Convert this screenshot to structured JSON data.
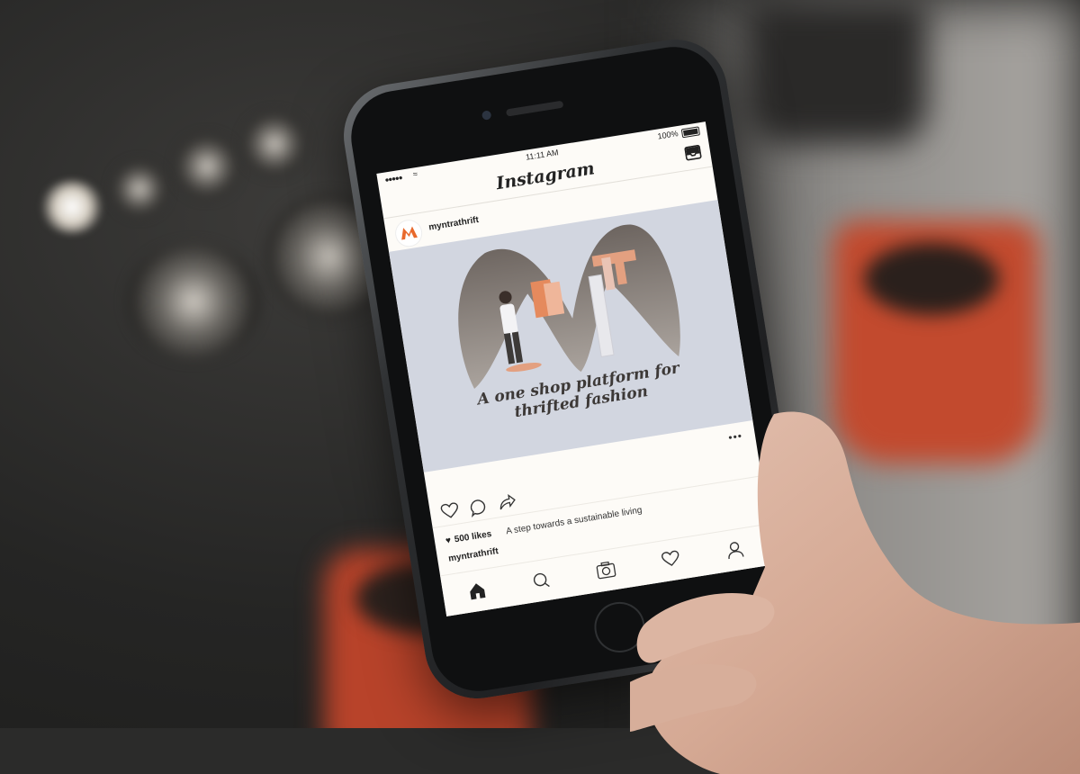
{
  "status_bar": {
    "signal": "●●●●●",
    "time": "11:11 AM",
    "battery": "100%"
  },
  "app": {
    "title": "Instagram"
  },
  "post": {
    "username": "myntrathrift",
    "tagline_line1": "A one shop platform for",
    "tagline_line2": "thrifted fashion",
    "likes": "500 likes",
    "caption_user": "myntrathrift",
    "caption": "A step towards a sustainable living"
  },
  "icons": {
    "inbox": "inbox-icon",
    "like": "heart-icon",
    "comment": "comment-icon",
    "share": "share-icon",
    "more": "more-icon",
    "home": "home-icon",
    "search": "search-icon",
    "camera": "camera-icon",
    "activity": "heart-icon",
    "profile": "profile-icon"
  },
  "colors": {
    "logo_orange": "#e8692c",
    "post_bg": "#d2d6e0",
    "cup_red": "#c24a2e"
  }
}
